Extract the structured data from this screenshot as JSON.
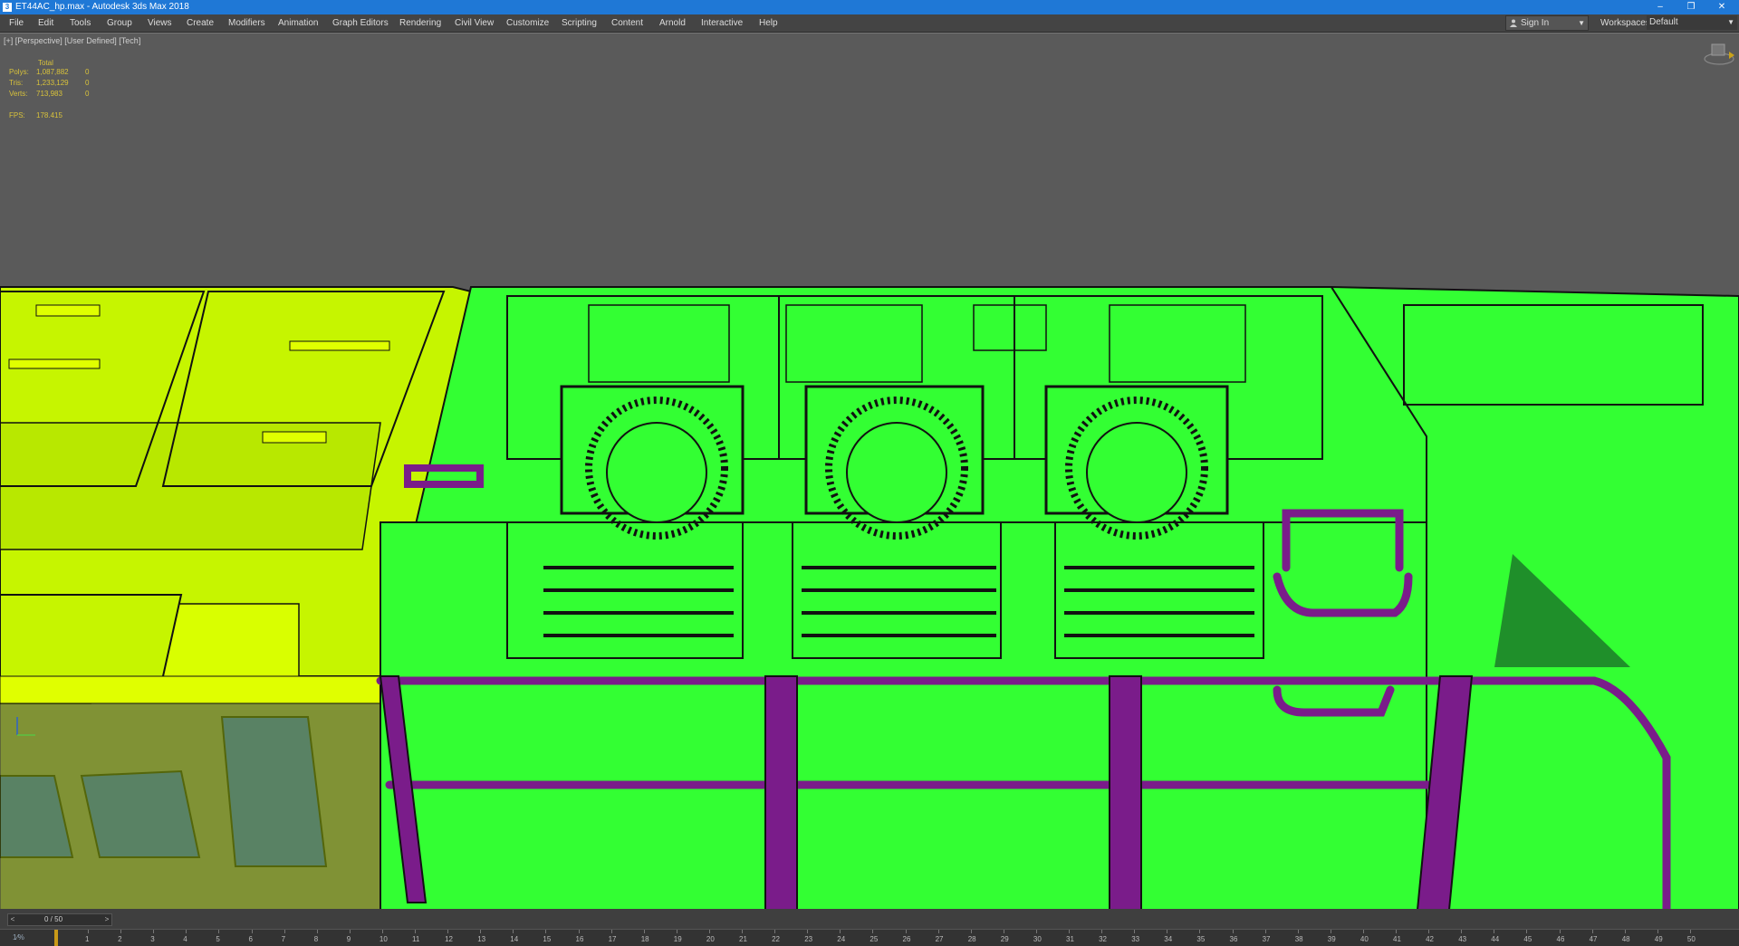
{
  "window": {
    "title": "ET44AC_hp.max - Autodesk 3ds Max 2018",
    "icon_label": "3",
    "controls": [
      "–",
      "❐",
      "✕"
    ]
  },
  "menu": {
    "items": [
      "File",
      "Edit",
      "Tools",
      "Group",
      "Views",
      "Create",
      "Modifiers",
      "Animation",
      "Graph Editors",
      "Rendering",
      "Civil View",
      "Customize",
      "Scripting",
      "Content",
      "Arnold",
      "Interactive",
      "Help"
    ],
    "sign_in": "Sign In",
    "workspaces_label": "Workspaces:",
    "workspaces_value": "Default"
  },
  "viewport": {
    "label": "[+] [Perspective] [User Defined] [Tech]",
    "stats": {
      "header": "Total",
      "polys_label": "Polys:",
      "polys_total": "1,087,882",
      "polys_sel": "0",
      "tris_label": "Tris:",
      "tris_total": "1,233,129",
      "tris_sel": "0",
      "verts_label": "Verts:",
      "verts_total": "713,983",
      "verts_sel": "0",
      "fps_label": "FPS:",
      "fps_value": "178.415"
    }
  },
  "timeline": {
    "frame_display": "0 / 50",
    "prev": "<",
    "next": ">",
    "key_label": "1⁄%",
    "ticks": [
      "1",
      "2",
      "3",
      "4",
      "5",
      "6",
      "7",
      "8",
      "9",
      "10",
      "11",
      "12",
      "13",
      "14",
      "15",
      "16",
      "17",
      "18",
      "19",
      "20",
      "21",
      "22",
      "23",
      "24",
      "25",
      "26",
      "27",
      "28",
      "29",
      "30",
      "31",
      "32",
      "33",
      "34",
      "35",
      "36",
      "37",
      "38",
      "39",
      "40",
      "41",
      "42",
      "43",
      "44",
      "45",
      "46",
      "47",
      "48",
      "49",
      "50"
    ]
  },
  "colors": {
    "title_bar": "#1f78d6",
    "locomotive_body": "#33ff33",
    "cab_section": "#c6f500",
    "handrail": "#7a1c8a",
    "window_glass": "#1a3fa8",
    "stats_text": "#d8c23b"
  }
}
